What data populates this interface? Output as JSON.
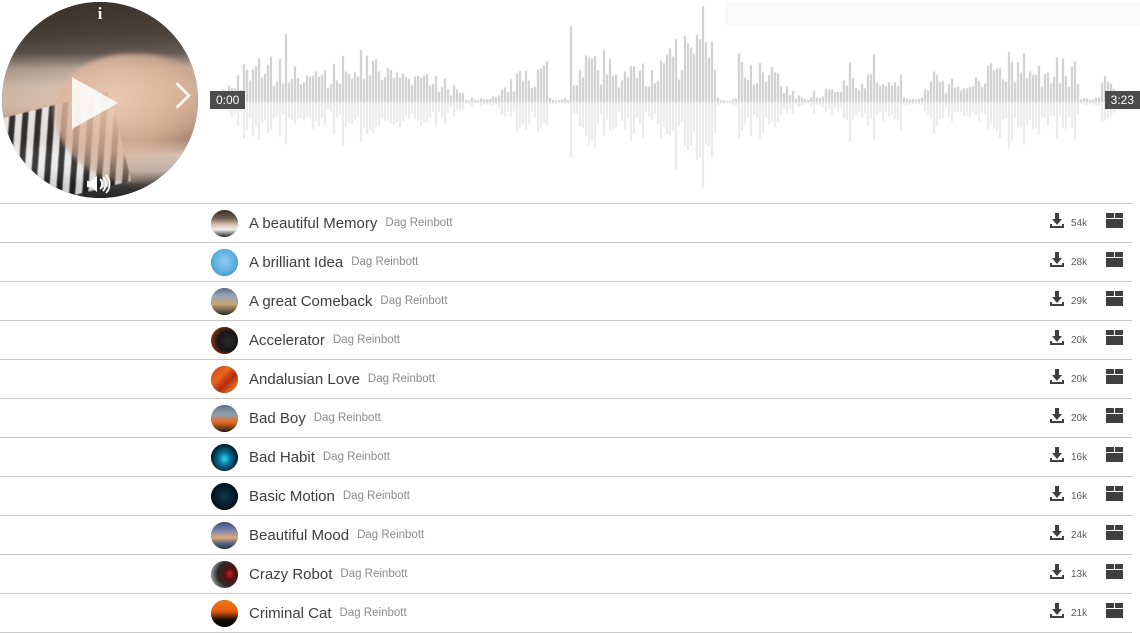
{
  "player": {
    "info_icon": "info-icon",
    "play_icon": "play-icon",
    "next_icon": "next-track-icon",
    "volume_icon": "volume-icon",
    "artwork_description": "hands playing piano keys"
  },
  "waveform": {
    "current_time": "0:00",
    "total_time": "3:23",
    "color_top": "#cccccc",
    "color_bottom": "#e9e9e9"
  },
  "tracks": [
    {
      "title": "A beautiful Memory",
      "artist": "Dag Reinbott",
      "downloads": "54k",
      "art": "piano"
    },
    {
      "title": "A brilliant Idea",
      "artist": "Dag Reinbott",
      "downloads": "28k",
      "art": "sky"
    },
    {
      "title": "A great Comeback",
      "artist": "Dag Reinbott",
      "downloads": "29k",
      "art": "runner"
    },
    {
      "title": "Accelerator",
      "artist": "Dag Reinbott",
      "downloads": "20k",
      "art": "lens"
    },
    {
      "title": "Andalusian Love",
      "artist": "Dag Reinbott",
      "downloads": "20k",
      "art": "guitar"
    },
    {
      "title": "Bad Boy",
      "artist": "Dag Reinbott",
      "downloads": "20k",
      "art": "car"
    },
    {
      "title": "Bad Habit",
      "artist": "Dag Reinbott",
      "downloads": "16k",
      "art": "wave"
    },
    {
      "title": "Basic Motion",
      "artist": "Dag Reinbott",
      "downloads": "16k",
      "art": "lines"
    },
    {
      "title": "Beautiful Mood",
      "artist": "Dag Reinbott",
      "downloads": "24k",
      "art": "sunset"
    },
    {
      "title": "Crazy Robot",
      "artist": "Dag Reinbott",
      "downloads": "13k",
      "art": "robot"
    },
    {
      "title": "Criminal Cat",
      "artist": "Dag Reinbott",
      "downloads": "21k",
      "art": "cat"
    }
  ],
  "icons": {
    "download": "download-icon",
    "box": "box-icon"
  }
}
